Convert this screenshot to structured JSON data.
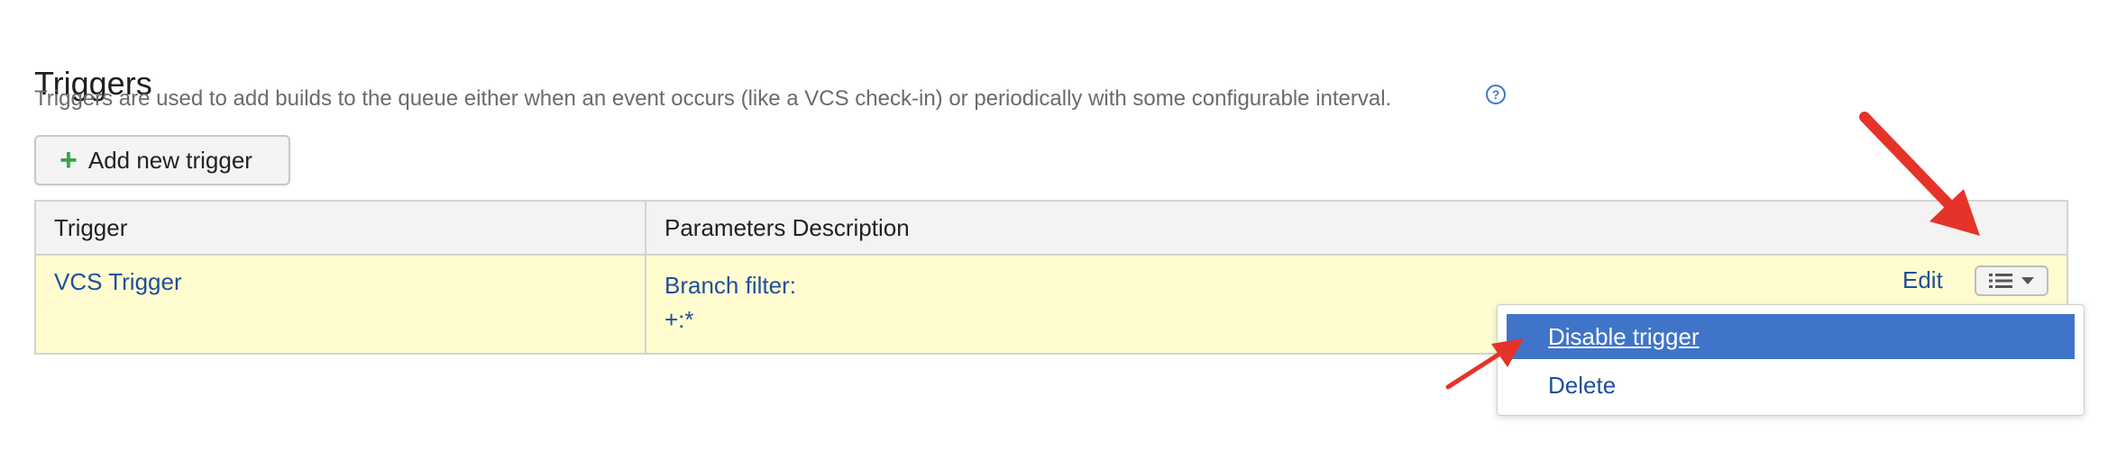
{
  "section": {
    "title": "Triggers",
    "description": "Triggers are used to add builds to the queue either when an event occurs (like a VCS check-in) or periodically with some configurable interval."
  },
  "add_button": {
    "icon": "+",
    "label": "Add new trigger"
  },
  "table": {
    "headers": [
      "Trigger",
      "Parameters Description"
    ],
    "rows": [
      {
        "trigger": "VCS Trigger",
        "param_label": "Branch filter:",
        "param_value": "+:*",
        "edit_label": "Edit"
      }
    ]
  },
  "dropdown": {
    "items": [
      {
        "label": "Disable trigger",
        "highlighted": true
      },
      {
        "label": "Delete",
        "highlighted": false
      }
    ]
  },
  "colors": {
    "link": "#1f4f9c",
    "highlight": "#3f74c9",
    "row_background": "#fffdd0",
    "annotation_arrow": "#e5332a",
    "add_icon": "#3aa14a"
  },
  "icons": {
    "help": "question-circle-icon",
    "menu": "list-icon",
    "caret": "chevron-down-icon",
    "add": "plus-icon"
  }
}
